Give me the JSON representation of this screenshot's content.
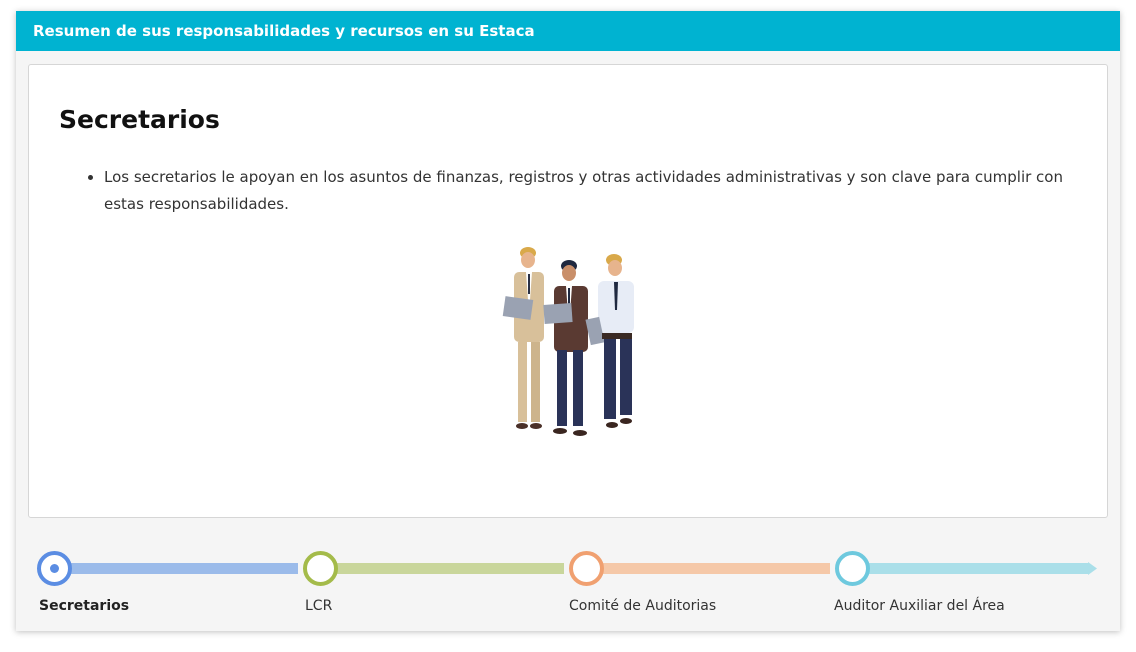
{
  "header": {
    "title": "Resumen de sus responsabilidades y recursos en su Estaca"
  },
  "card": {
    "title": "Secretarios",
    "bullets": [
      "Los secretarios le apoyan en los asuntos de finanzas, registros y otras actividades administrativas y son clave para cumplir con estas responsabilidades."
    ]
  },
  "timeline": {
    "active_index": 0,
    "steps": [
      {
        "label": "Secretarios",
        "color": "#5b8de3",
        "bar_color": "#9bbbea"
      },
      {
        "label": "LCR",
        "color": "#a4bb4a",
        "bar_color": "#c9d69b"
      },
      {
        "label": "Comité de Auditorias",
        "color": "#f0a070",
        "bar_color": "#f5c8a8"
      },
      {
        "label": "Auditor Auxiliar del Área",
        "color": "#6ec9de",
        "bar_color": "#aadfe9"
      }
    ]
  }
}
